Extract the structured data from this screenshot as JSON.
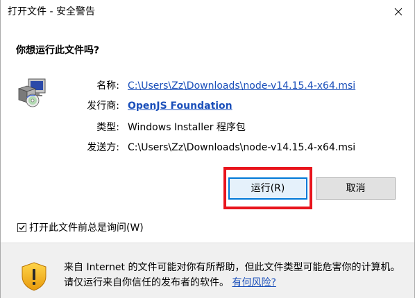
{
  "window": {
    "title": "打开文件 - 安全警告"
  },
  "dialog": {
    "question": "你想运行此文件吗?",
    "fields": {
      "name_label": "名称:",
      "name_value": "C:\\Users\\Zz\\Downloads\\node-v14.15.4-x64.msi",
      "publisher_label": "发行商:",
      "publisher_value": "OpenJS Foundation",
      "type_label": "类型:",
      "type_value": "Windows Installer 程序包",
      "from_label": "发送方:",
      "from_value": "C:\\Users\\Zz\\Downloads\\node-v14.15.4-x64.msi"
    },
    "buttons": {
      "run_label": "运行(R)",
      "cancel_label": "取消"
    },
    "checkbox": {
      "label": "打开此文件前总是询问(W)",
      "checked": true
    },
    "footer": {
      "warning_text": "来自 Internet 的文件可能对你有所帮助，但此文件类型可能危害你的计算机。请仅运行来自你信任的发布者的软件。",
      "risk_link": "有何风险?"
    }
  },
  "colors": {
    "link": "#1a4fba",
    "highlight_border": "#e8141c",
    "default_button_border": "#0078d7",
    "footer_bg": "#f0f0f0"
  },
  "icons": {
    "close": "close-icon",
    "file": "installer-package-icon",
    "warning": "warning-shield-icon",
    "check": "checkmark-icon"
  }
}
